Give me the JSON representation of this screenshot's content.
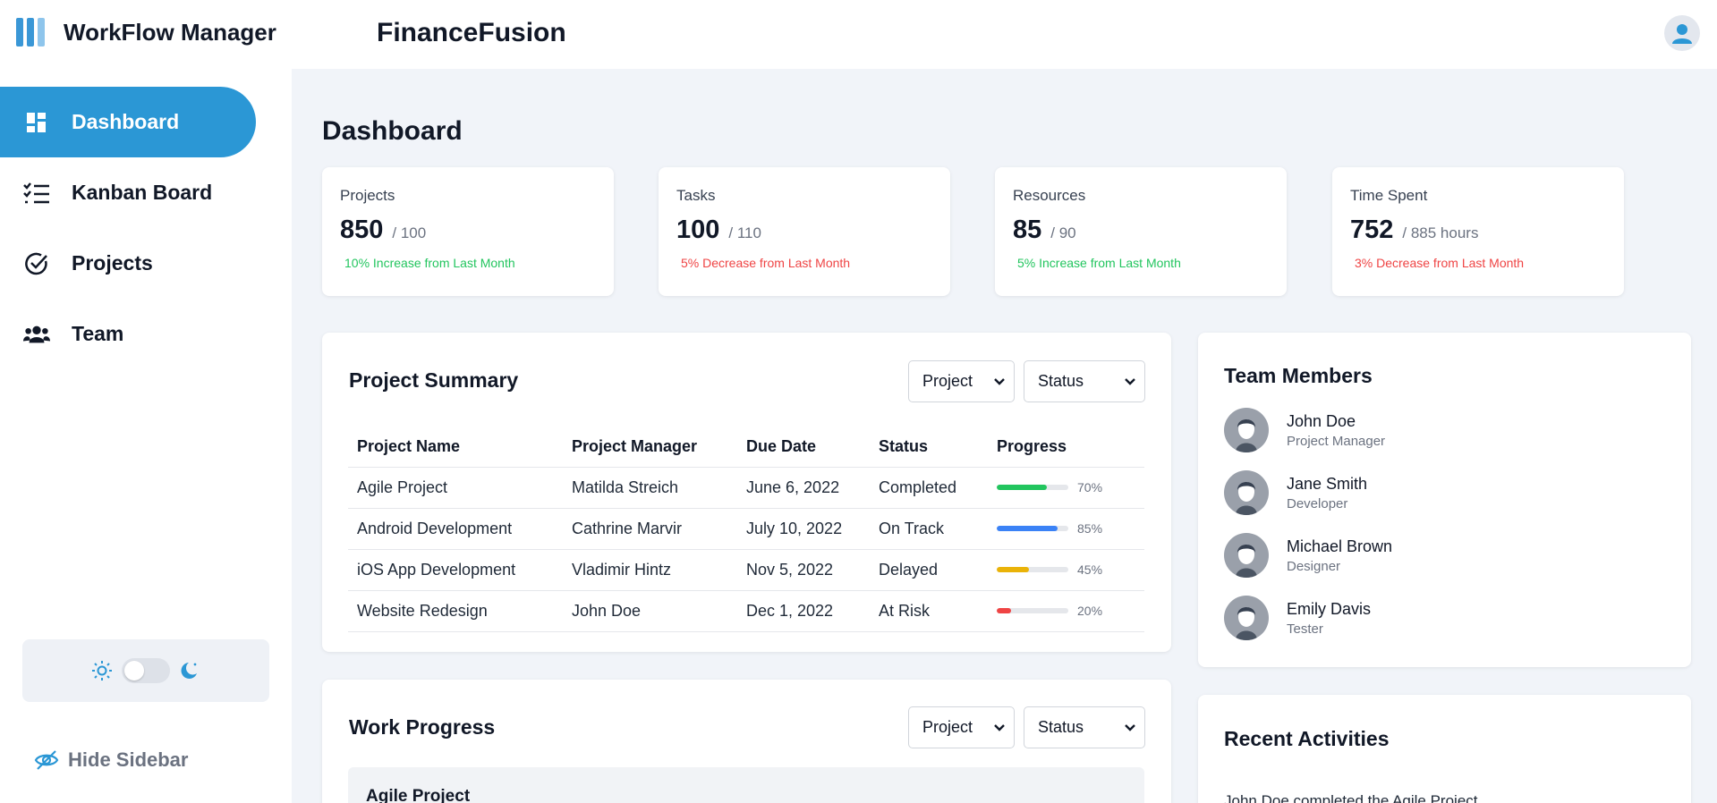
{
  "header": {
    "brand": "WorkFlow Manager",
    "app_title": "FinanceFusion",
    "user_icon": "user-circle-icon"
  },
  "sidebar": {
    "items": [
      {
        "label": "Dashboard",
        "icon": "dashboard-icon",
        "active": true
      },
      {
        "label": "Kanban Board",
        "icon": "checklist-icon",
        "active": false
      },
      {
        "label": "Projects",
        "icon": "check-circle-icon",
        "active": false
      },
      {
        "label": "Team",
        "icon": "users-icon",
        "active": false
      }
    ],
    "theme_toggle": {
      "light_icon": "sun-icon",
      "dark_icon": "moon-icon",
      "dark_mode": false
    },
    "hide_label": "Hide Sidebar"
  },
  "main": {
    "heading": "Dashboard",
    "stats": [
      {
        "label": "Projects",
        "value": "850",
        "total": "/ 100",
        "change": "10% Increase from Last Month",
        "trend": "up"
      },
      {
        "label": "Tasks",
        "value": "100",
        "total": "/ 110",
        "change": "5% Decrease from Last Month",
        "trend": "down"
      },
      {
        "label": "Resources",
        "value": "85",
        "total": "/ 90",
        "change": "5% Increase from Last Month",
        "trend": "up"
      },
      {
        "label": "Time Spent",
        "value": "752",
        "total": "/ 885 hours",
        "change": "3% Decrease from Last Month",
        "trend": "down"
      }
    ],
    "project_summary": {
      "title": "Project Summary",
      "filter_project": "Project",
      "filter_status": "Status",
      "columns": [
        "Project Name",
        "Project Manager",
        "Due Date",
        "Status",
        "Progress"
      ],
      "rows": [
        {
          "name": "Agile Project",
          "manager": "Matilda Streich",
          "due": "June 6, 2022",
          "status": "Completed",
          "progress": 70,
          "progress_label": "70%",
          "color": "#22c55e"
        },
        {
          "name": "Android Development",
          "manager": "Cathrine Marvir",
          "due": "July 10, 2022",
          "status": "On Track",
          "progress": 85,
          "progress_label": "85%",
          "color": "#3b82f6"
        },
        {
          "name": "iOS App Development",
          "manager": "Vladimir Hintz",
          "due": "Nov 5, 2022",
          "status": "Delayed",
          "progress": 45,
          "progress_label": "45%",
          "color": "#eab308"
        },
        {
          "name": "Website Redesign",
          "manager": "John Doe",
          "due": "Dec 1, 2022",
          "status": "At Risk",
          "progress": 20,
          "progress_label": "20%",
          "color": "#ef4444"
        }
      ]
    },
    "work_progress": {
      "title": "Work Progress",
      "filter_project": "Project",
      "filter_status": "Status",
      "first_item": "Agile Project"
    },
    "team": {
      "title": "Team Members",
      "members": [
        {
          "name": "John Doe",
          "role": "Project Manager"
        },
        {
          "name": "Jane Smith",
          "role": "Developer"
        },
        {
          "name": "Michael Brown",
          "role": "Designer"
        },
        {
          "name": "Emily Davis",
          "role": "Tester"
        }
      ]
    },
    "activities": {
      "title": "Recent Activities",
      "items": [
        "John Doe completed the Agile Project"
      ]
    }
  }
}
